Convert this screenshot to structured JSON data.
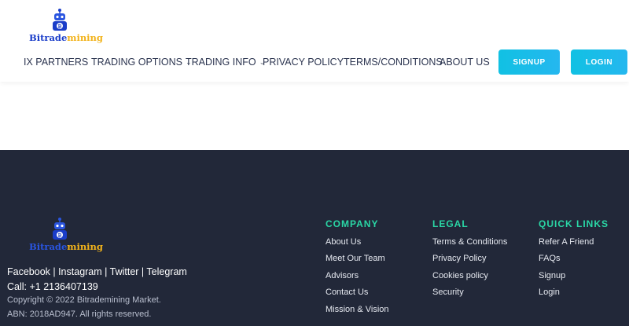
{
  "header": {
    "logo": {
      "part1": "Bitrade",
      "part2": "mining"
    },
    "nav": [
      {
        "label": "IX PARTNERS",
        "dropdown": false
      },
      {
        "label": "TRADING OPTIONS",
        "dropdown": true
      },
      {
        "label": "TRADING INFO",
        "dropdown": true
      },
      {
        "label": "PRIVACY POLICY",
        "dropdown": false
      },
      {
        "label": "TERMS/CONDITIONS",
        "dropdown": false
      },
      {
        "label": "ABOUT US",
        "dropdown": false
      }
    ],
    "signup_label": "SIGNUP",
    "login_label": "LOGIN"
  },
  "footer": {
    "logo": {
      "part1": "Bitrade",
      "part2": "mining"
    },
    "social": "Facebook | Instagram | Twitter | Telegram",
    "call": "Call: +1 2136407139",
    "copyright": "Copyright © 2022 Bitrademining Market.",
    "abn": "ABN: 2018AD947. All rights reserved.",
    "columns": [
      {
        "title": "COMPANY",
        "links": [
          "About Us",
          "Meet Our Team",
          "Advisors",
          "Contact Us",
          "Mission & Vision"
        ]
      },
      {
        "title": "LEGAL",
        "links": [
          "Terms & Conditions",
          "Privacy Policy",
          "Cookies policy",
          "Security"
        ]
      },
      {
        "title": "QUICK LINKS",
        "links": [
          "Refer A Friend",
          "FAQs",
          "Signup",
          "Login"
        ]
      }
    ]
  },
  "colors": {
    "accent": "#2ad6a5",
    "button": "#1bbce8",
    "footer_bg": "#222839",
    "logo_blue": "#1a3dc9",
    "logo_gold": "#f2b31b"
  }
}
